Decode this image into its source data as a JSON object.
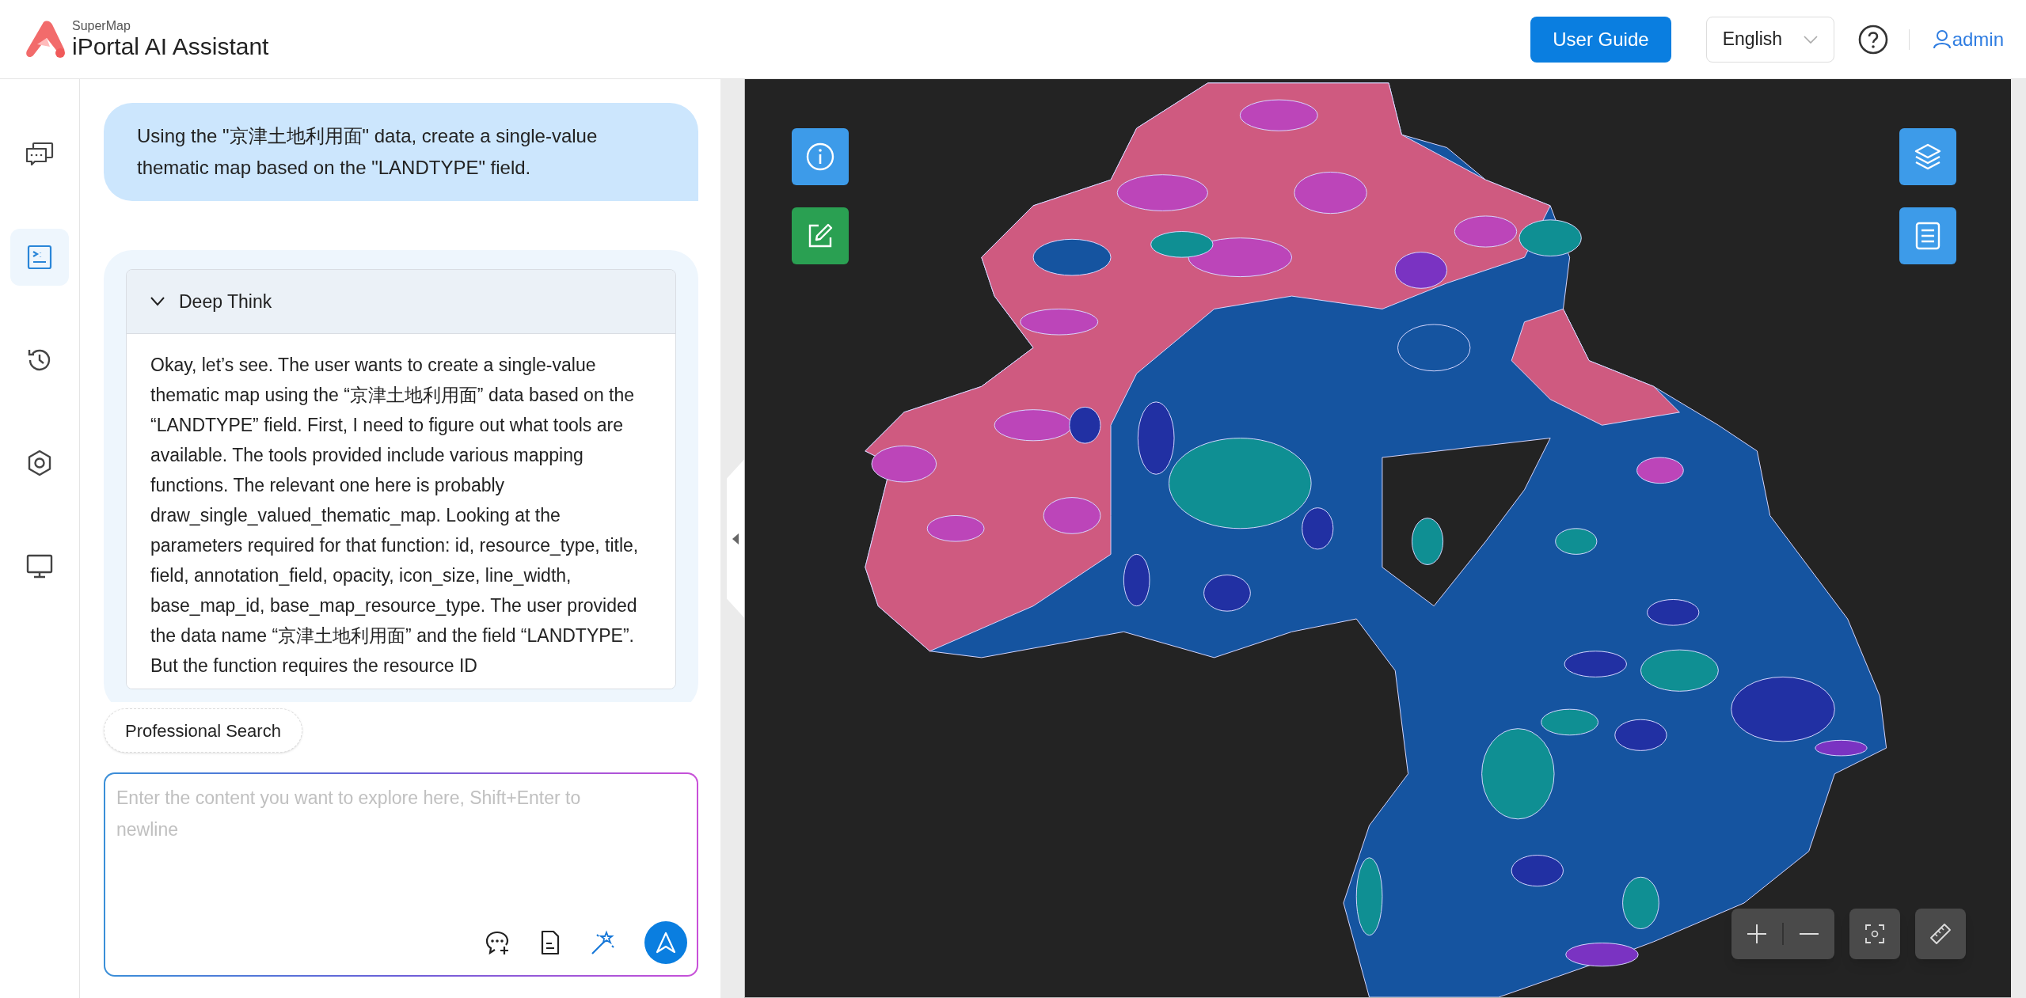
{
  "header": {
    "brand_small": "SuperMap",
    "brand_title": "iPortal AI Assistant",
    "user_guide_button": "User Guide",
    "language_select": "English",
    "user": "admin"
  },
  "sidebar": {
    "items": [
      {
        "kind": "chat",
        "selected": false
      },
      {
        "kind": "terminal",
        "selected": true
      },
      {
        "kind": "history",
        "selected": false
      },
      {
        "kind": "hexagon",
        "selected": false
      },
      {
        "kind": "monitor",
        "selected": false
      }
    ]
  },
  "chat": {
    "user_message": "Using the \"京津土地利用面\" data, create a single-value thematic map based on the \"LANDTYPE\" field.",
    "reasoning": {
      "title": "Deep Think",
      "expanded": true,
      "text": "Okay, let’s see. The user wants to create a single-value thematic map using the “京津土地利用面” data based on the “LANDTYPE” field. First, I need to figure out what tools are available. The tools provided include various mapping functions. The relevant one here is probably draw_single_valued_thematic_map. Looking at the parameters required for that function: id, resource_type, title, field, annotation_field, opacity, icon_size, line_width, base_map_id, base_map_resource_type. The user provided the data name “京津土地利用面” and the field “LANDTYPE”. But the function requires the resource ID"
    },
    "chips": [
      "Professional Search"
    ],
    "input": {
      "placeholder": "Enter the content you want to explore here, Shift+Enter to newline"
    }
  }
}
